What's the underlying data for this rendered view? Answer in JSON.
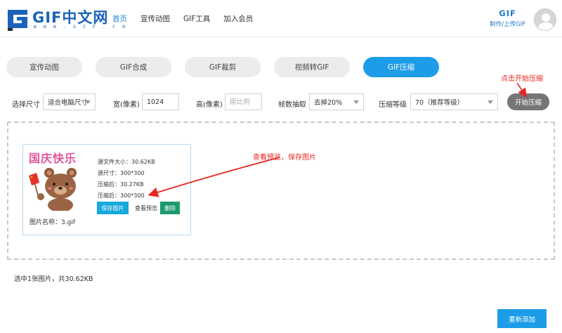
{
  "header": {
    "logo_text": "GIF中文网",
    "logo_url": "W W W . G I F . C N",
    "nav": [
      {
        "label": "首页",
        "active": true
      },
      {
        "label": "宣传动图",
        "active": false
      },
      {
        "label": "GIF工具",
        "active": false
      },
      {
        "label": "加入会员",
        "active": false
      }
    ],
    "user_title": "GIF",
    "user_sub": "制作/上传GIF"
  },
  "tabs": [
    {
      "label": "宣传动图",
      "active": false
    },
    {
      "label": "GIF合成",
      "active": false
    },
    {
      "label": "GIF裁剪",
      "active": false
    },
    {
      "label": "视频转GIF",
      "active": false
    },
    {
      "label": "GIF压缩",
      "active": true
    }
  ],
  "options": {
    "size_label": "选择尺寸",
    "size_value": "适合电脑尺寸",
    "width_label": "宽(像素)",
    "width_value": "1024",
    "height_label": "高(像素)",
    "height_placeholder": "原比例",
    "frame_label": "帧数抽取",
    "frame_value": "去掉20%",
    "level_label": "压缩等级",
    "level_value": "70（推荐等级）",
    "start_label": "开始压缩"
  },
  "annotations": {
    "start_hint": "点击开始压缩",
    "preview_hint": "查看预览，保存图片"
  },
  "card": {
    "pic_title": "国庆快乐",
    "info_lines": [
      "源文件大小：30.62KB",
      "源尺寸：300*300",
      "压缩后：30.27KB",
      "压缩后：300*300"
    ],
    "save_label": "保存图片",
    "preview_label": "查看预览",
    "delete_label": "删除",
    "filename": "图片名称：3.gif"
  },
  "summary": "选中1张图片，共30.62KB",
  "readd_label": "重新添加",
  "colors": {
    "accent": "#1d9ce8",
    "brand": "#1b62b8",
    "annotation": "#e8251f",
    "delete": "#1b9a6e"
  }
}
